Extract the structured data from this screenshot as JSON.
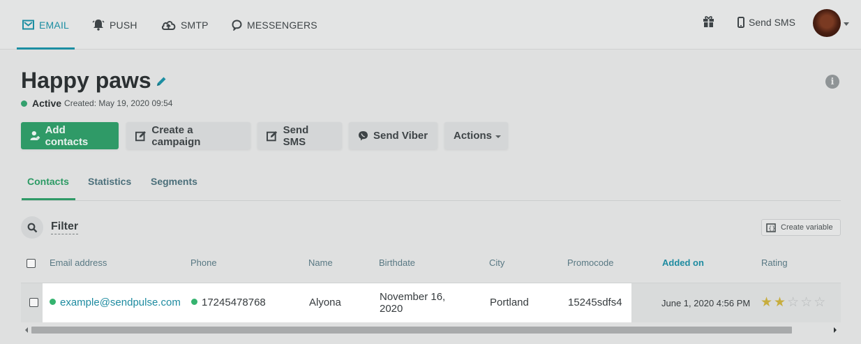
{
  "nav": {
    "items": [
      {
        "label": "EMAIL",
        "icon": "envelope-icon",
        "active": true
      },
      {
        "label": "PUSH",
        "icon": "bell-icon"
      },
      {
        "label": "SMTP",
        "icon": "cloud-upload-icon"
      },
      {
        "label": "MESSENGERS",
        "icon": "chat-bubble-icon"
      }
    ],
    "send_sms": "Send SMS",
    "gift_icon": "gift-icon",
    "avatar_icon": "user-avatar"
  },
  "book": {
    "title": "Happy paws",
    "status": "Active",
    "created": "Created: May 19, 2020 09:54"
  },
  "actions": {
    "add_contacts": "Add contacts",
    "create_campaign": "Create a campaign",
    "send_sms": "Send SMS",
    "send_viber": "Send Viber",
    "actions": "Actions"
  },
  "tabs": [
    "Contacts",
    "Statistics",
    "Segments"
  ],
  "filter": {
    "label": "Filter",
    "create_variable": "Create variable"
  },
  "table": {
    "columns": [
      "Email address",
      "Phone",
      "Name",
      "Birthdate",
      "City",
      "Promocode",
      "Added on",
      "Rating"
    ],
    "sorted_column": "Added on",
    "rows": [
      {
        "email": "example@sendpulse.com",
        "phone": "17245478768",
        "name": "Alyona",
        "birthdate_line1": "November 16,",
        "birthdate_line2": "2020",
        "city": "Portland",
        "promocode": "15245sdfs4",
        "added_on": "June 1, 2020 4:56 PM",
        "rating": 2,
        "rating_max": 5
      }
    ]
  },
  "colors": {
    "accent": "#1c8ea2",
    "primary_button": "#2f9a67",
    "active_status": "#34a06e"
  }
}
